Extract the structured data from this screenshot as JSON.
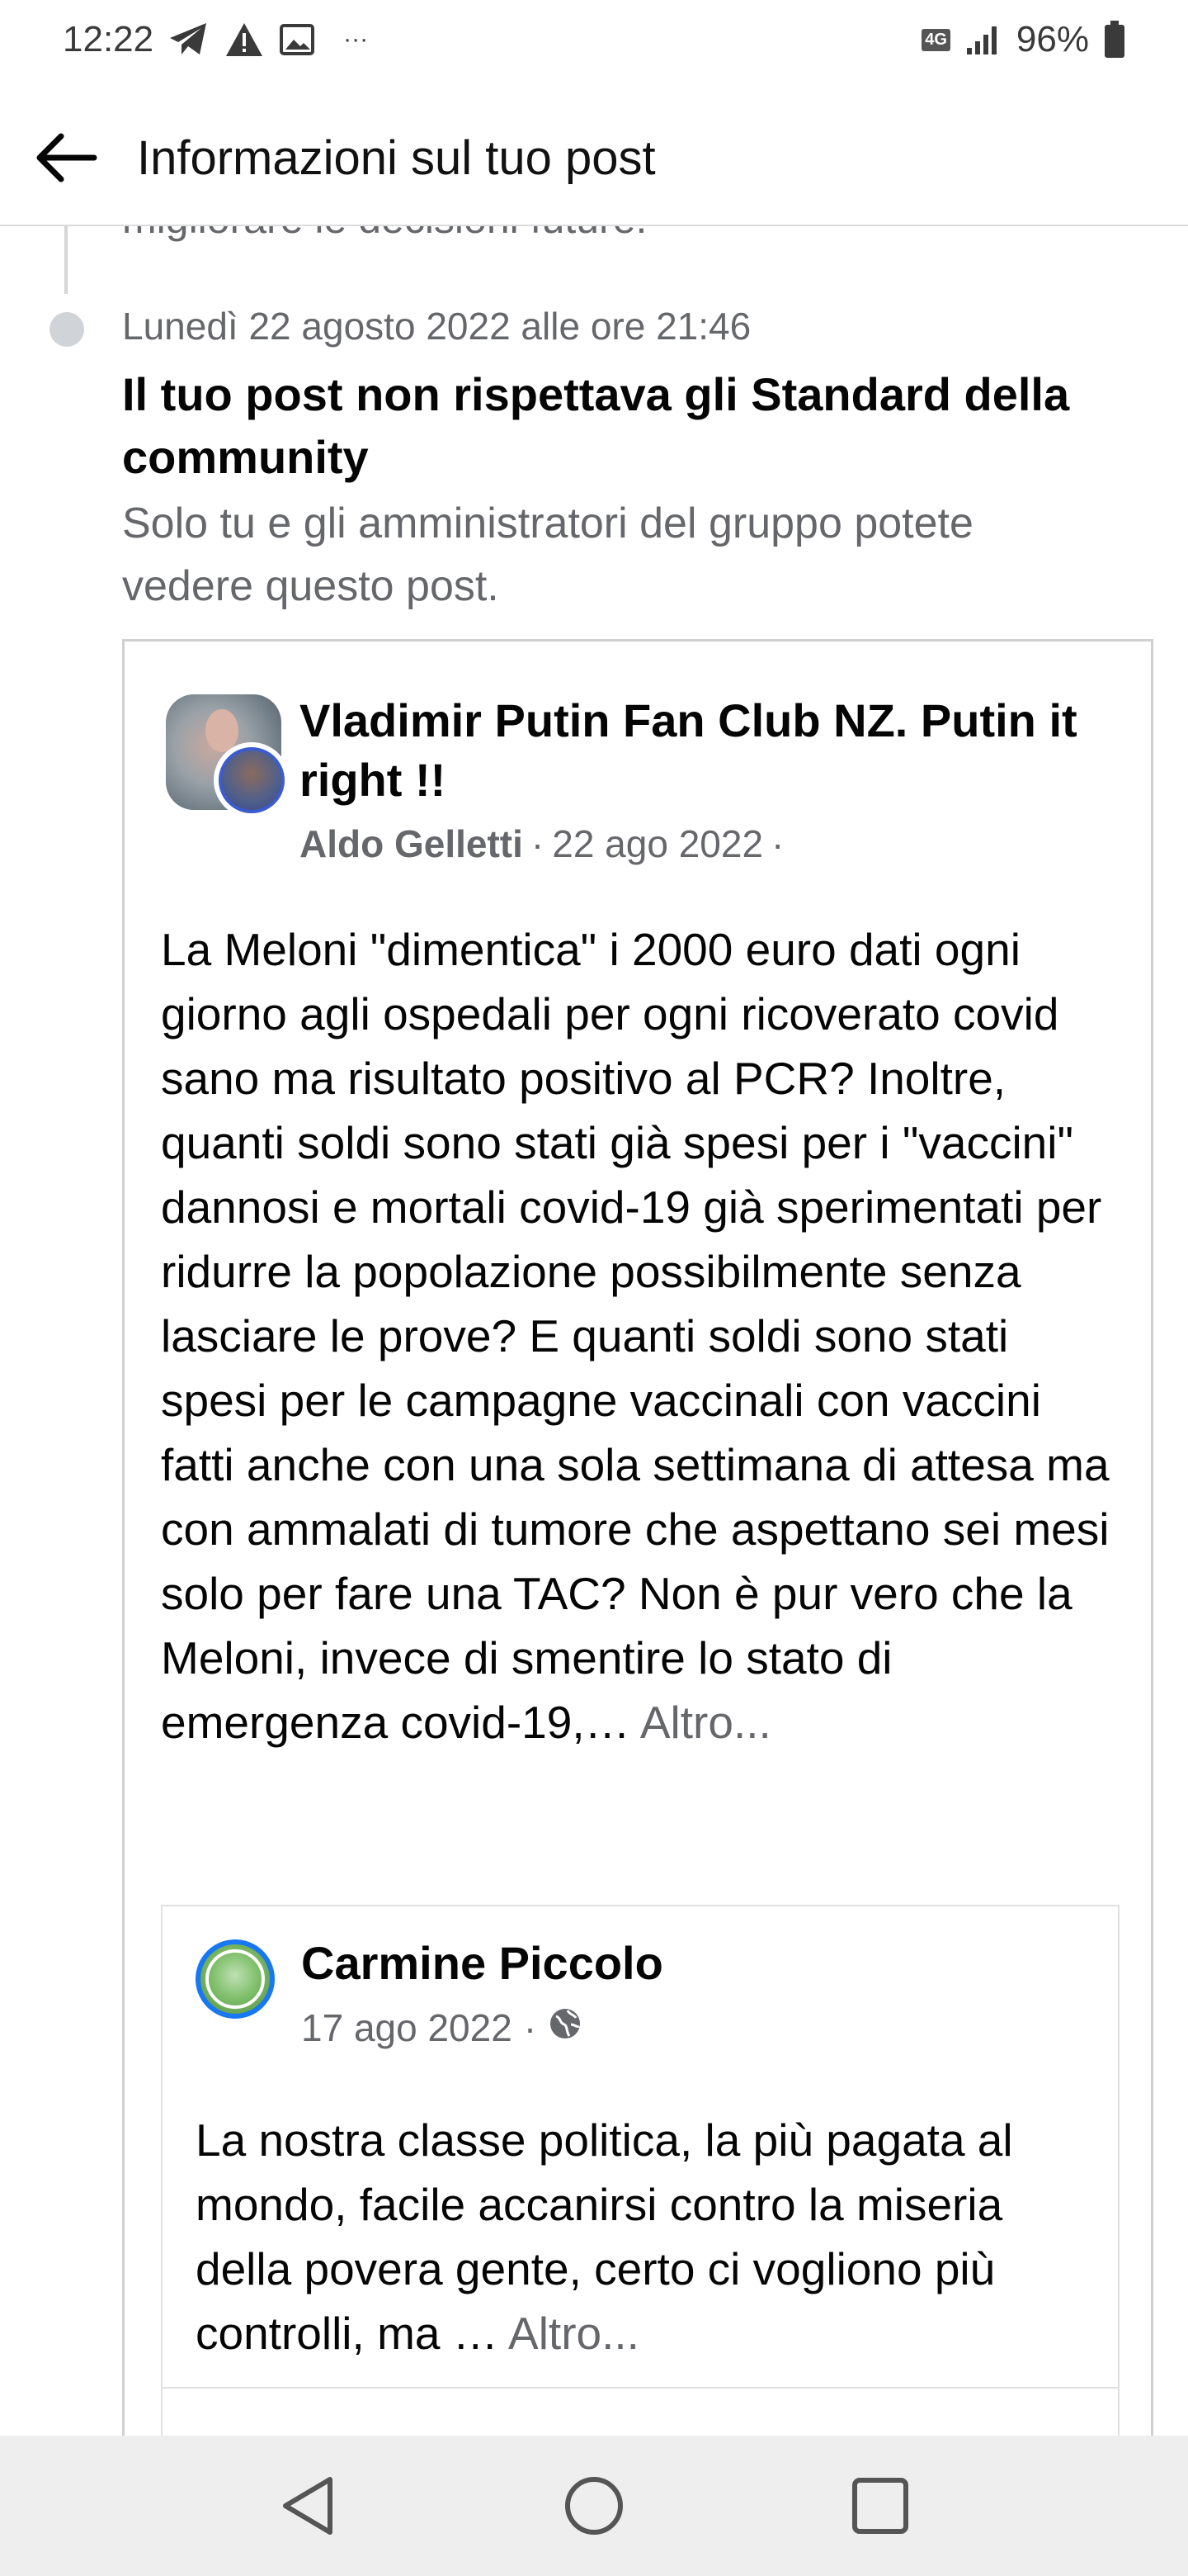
{
  "status_bar": {
    "time": "12:22",
    "network": "4G",
    "battery": "96%",
    "more": "···",
    "icons": [
      "telegram-icon",
      "warning-icon",
      "image-icon",
      "signal-icon",
      "battery-icon"
    ]
  },
  "app_bar": {
    "title": "Informazioni sul tuo post"
  },
  "timeline": {
    "previous_text": "migliorare le decisioni future.",
    "event_date": "Lunedì 22 agosto 2022 alle ore 21:46",
    "event_title": "Il tuo post non rispettava gli Standard della community",
    "event_desc": "Solo tu e gli amministratori del gruppo potete vedere questo post."
  },
  "post": {
    "group_name": "Vladimir Putin Fan Club NZ. Putin it right !!",
    "author": "Aldo Gelletti",
    "separator": "·",
    "date": "22 ago 2022",
    "trailing": "·",
    "body": "La Meloni \"dimentica\" i 2000 euro dati ogni giorno agli ospedali per ogni ricoverato covid sano ma risultato positivo al PCR? Inoltre, quanti soldi sono stati già spesi per i \"vaccini\" dannosi e mortali covid-19 già sperimentati per ridurre la popolazione possibilmente senza lasciare le prove? E quanti soldi sono stati spesi per le campagne vaccinali con vaccini fatti anche con una sola settimana di attesa ma con ammalati di tumore che aspettano sei mesi solo per fare una TAC? Non è pur vero che la Meloni, invece di smentire lo stato di emergenza covid-19,… ",
    "more": "Altro..."
  },
  "shared_post": {
    "name": "Carmine Piccolo",
    "date": "17 ago 2022",
    "separator": "·",
    "body": "La nostra classe politica, la più pagata al mondo, facile accanirsi contro la miseria della  povera gente, certo ci vogliono più controlli, ma … ",
    "more": "Altro..."
  },
  "colors": {
    "secondary_text": "#65676b",
    "accent": "#1877f2",
    "nav_bar": "#eeeeee"
  }
}
